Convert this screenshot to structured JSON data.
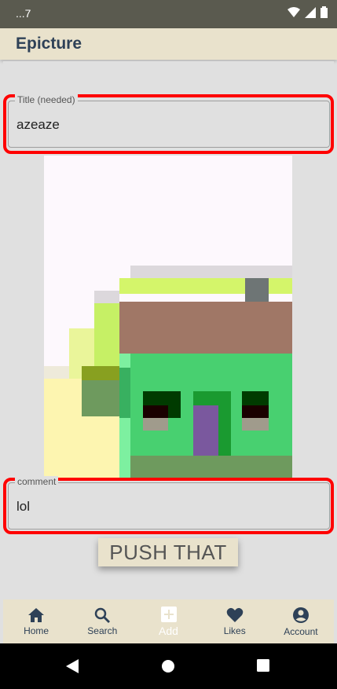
{
  "status_bar": {
    "time": "...7"
  },
  "app_bar": {
    "title": "Epicture"
  },
  "form": {
    "title_field": {
      "label": "Title (needed)",
      "value": "azeaze"
    },
    "comment_field": {
      "label": "comment",
      "value": "lol"
    },
    "submit_label": "PUSH THAT"
  },
  "bottom_nav": {
    "items": [
      {
        "label": "Home",
        "icon": "home-icon"
      },
      {
        "label": "Search",
        "icon": "search-icon"
      },
      {
        "label": "Add",
        "icon": "add-icon"
      },
      {
        "label": "Likes",
        "icon": "heart-icon"
      },
      {
        "label": "Account",
        "icon": "account-icon"
      }
    ],
    "active": "Add"
  },
  "colors": {
    "app_bar_bg": "#e9e2cc",
    "title_text": "#2e4157",
    "highlight_outline": "#ff0000",
    "content_bg": "#e0e0e0"
  }
}
